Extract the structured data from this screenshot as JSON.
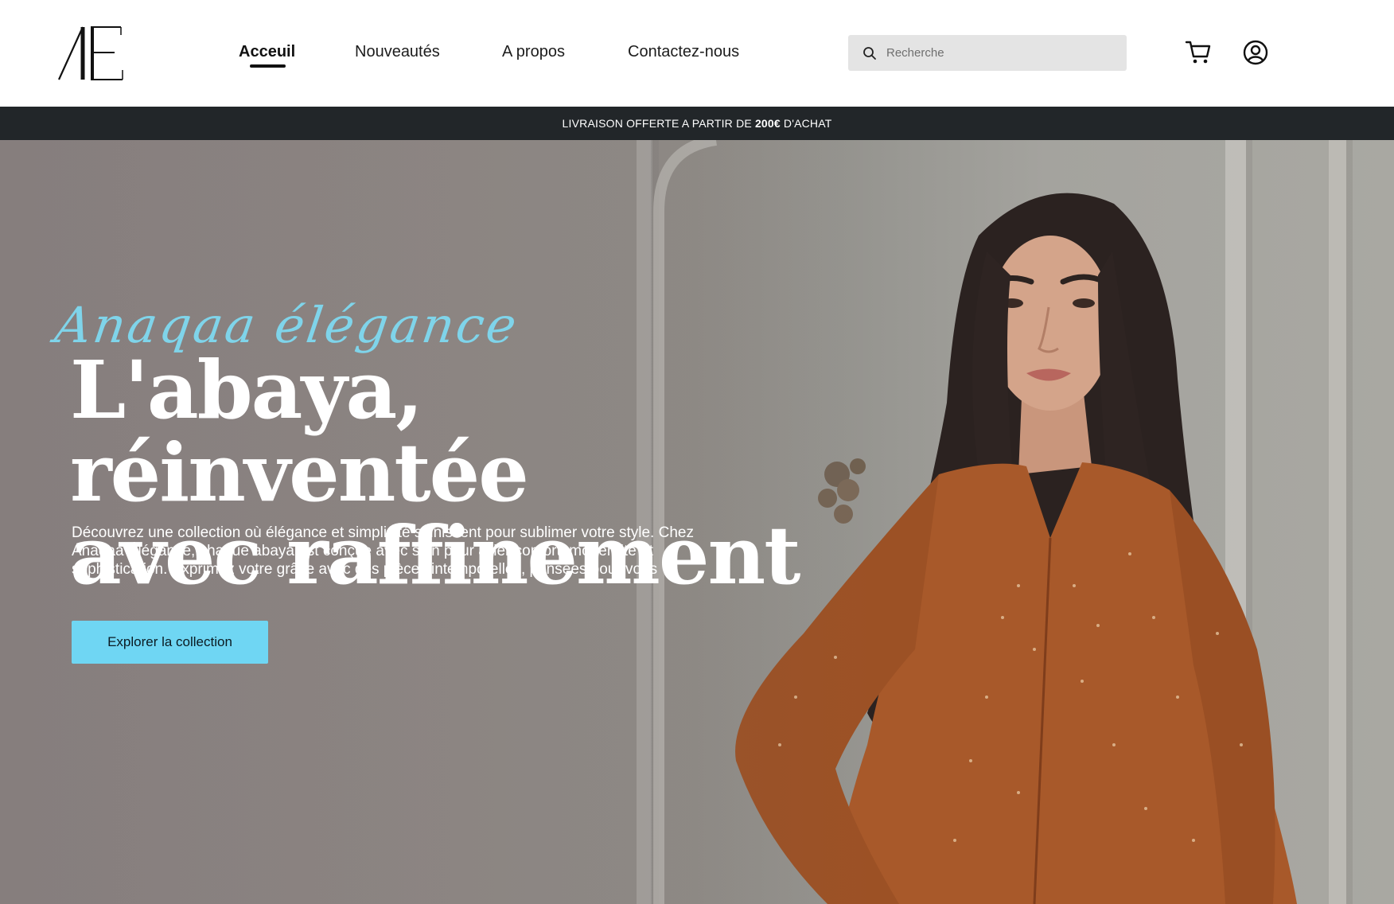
{
  "brand": {
    "logo_text": "/'E",
    "logo_icon": "anaqaa-elegance-monogram"
  },
  "nav": {
    "items": [
      {
        "label": "Acceuil",
        "active": true
      },
      {
        "label": "Nouveautés",
        "active": false
      },
      {
        "label": "A propos",
        "active": false
      },
      {
        "label": "Contactez-nous",
        "active": false
      }
    ]
  },
  "search": {
    "placeholder": "Recherche",
    "icon": "search-icon"
  },
  "header_icons": {
    "cart": "cart-icon",
    "account": "user-circle-icon"
  },
  "promo": {
    "prefix": "LIVRAISON OFFERTE A PARTIR DE",
    "amount": "200€",
    "suffix": "D'ACHAT"
  },
  "hero": {
    "script_title": "Anaqaa élégance",
    "headline_line1": "L'abaya, réinventée",
    "headline_line2": "avec raffinement",
    "description": "Découvrez une collection où élégance et simplicité s'unissent pour sublimer votre style. Chez Anaqaa Élégance, chaque abaya est conçue avec soin pour allier confort, modernité et sophistication. Exprimez votre grâce avec des pièces intemporelles, pensées pour vous",
    "cta_label": "Explorer la collection"
  },
  "colors": {
    "accent": "#6fd6f3",
    "script": "#7fd4ea",
    "promo_bg": "#222629",
    "abaya": "#a8592a"
  }
}
